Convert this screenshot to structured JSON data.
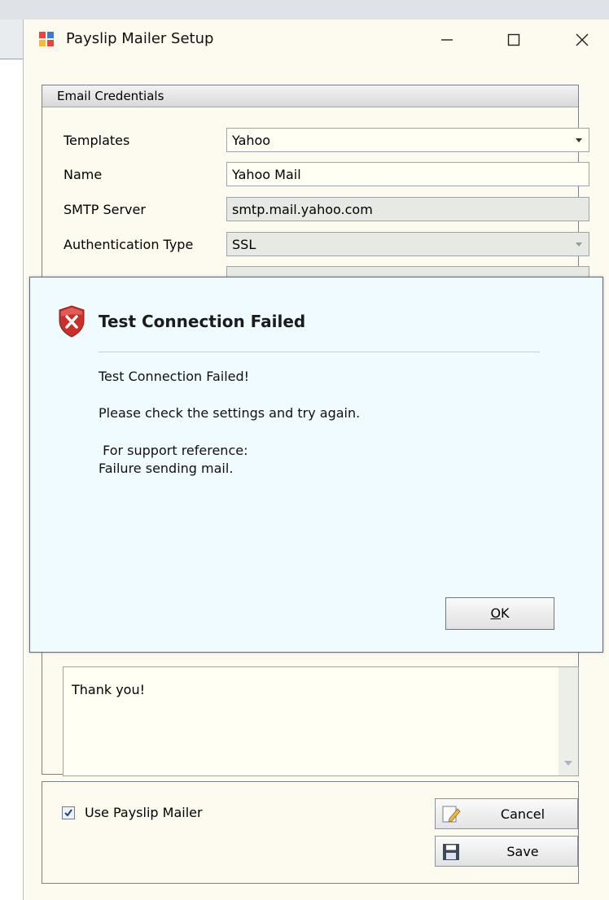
{
  "window": {
    "title": "Payslip Mailer Setup"
  },
  "credentials": {
    "group_title": "Email Credentials",
    "fields": [
      {
        "label": "Templates",
        "value": "Yahoo"
      },
      {
        "label": "Name",
        "value": "Yahoo Mail"
      },
      {
        "label": "SMTP Server",
        "value": "smtp.mail.yahoo.com"
      },
      {
        "label": "Authentication Type",
        "value": "SSL"
      }
    ]
  },
  "message_body": {
    "visible_text": "Thank you!"
  },
  "footer": {
    "use_mailer_label": "Use Payslip Mailer",
    "use_mailer_checked": true,
    "cancel_label": "Cancel",
    "save_label": "Save"
  },
  "dialog": {
    "title": "Test Connection Failed",
    "line1": "Test Connection Failed!",
    "line2": "Please check the settings and try again.",
    "line3": " For support reference:",
    "line4": "Failure sending mail.",
    "ok_prefix": "",
    "ok_accel": "O",
    "ok_suffix": "K"
  },
  "icons": {
    "app": "mailer-app-icon",
    "error": "error-shield-icon",
    "cancel": "cancel-pencil-icon",
    "save": "floppy-disk-icon"
  }
}
